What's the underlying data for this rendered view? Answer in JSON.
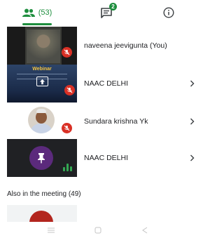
{
  "tabs": {
    "people_count": "(53)",
    "chat_badge": "2"
  },
  "participants": [
    {
      "name": "naveena jeevigunta (You)",
      "muted": true
    },
    {
      "name": "NAAC DELHI",
      "muted": true,
      "tile_title": "Webinar"
    },
    {
      "name": "Sundara krishna Yk",
      "muted": true
    },
    {
      "name": "NAAC DELHI",
      "muted": false
    }
  ],
  "section": {
    "also_in_meeting": "Also in the meeting (49)"
  },
  "colors": {
    "accent": "#1e8e3e",
    "mute": "#d93025"
  },
  "icons": [
    "people-icon",
    "chat-icon",
    "info-icon",
    "mic-off-icon",
    "chevron-right-icon",
    "pin-icon",
    "audio-level-icon",
    "share-screen-icon"
  ]
}
